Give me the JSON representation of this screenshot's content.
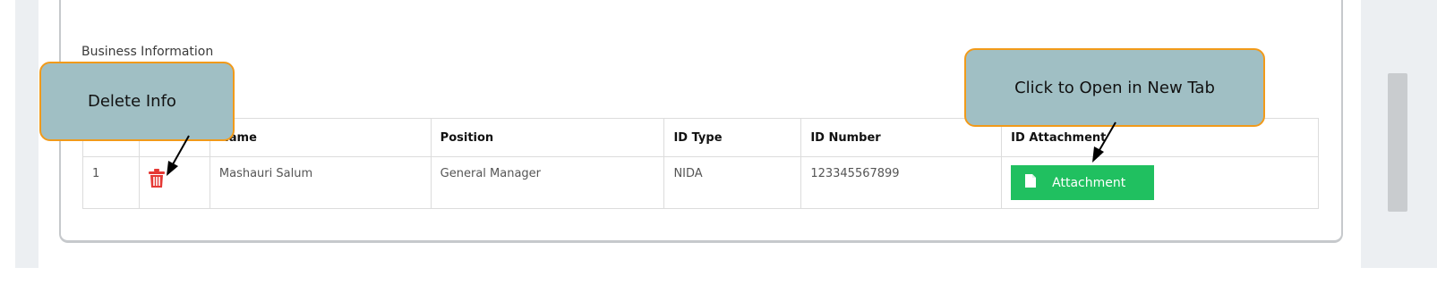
{
  "section": {
    "title": "Business Information"
  },
  "table": {
    "headers": [
      "#",
      "",
      "Name",
      "Position",
      "ID Type",
      "ID Number",
      "ID Attachment"
    ],
    "rows": [
      {
        "index": "1",
        "name": "Mashauri Salum",
        "position": "General Manager",
        "id_type": "NIDA",
        "id_number": "123345567899",
        "attachment_label": "Attachment"
      }
    ]
  },
  "callouts": {
    "delete": "Delete Info",
    "open": "Click to Open in New Tab"
  },
  "colors": {
    "attachment_button": "#20c060",
    "delete_icon": "#e53935",
    "callout_fill": "#a0bfc4",
    "callout_border": "#f19a1a"
  },
  "icons": {
    "delete": "trash-icon",
    "attachment": "document-icon"
  }
}
